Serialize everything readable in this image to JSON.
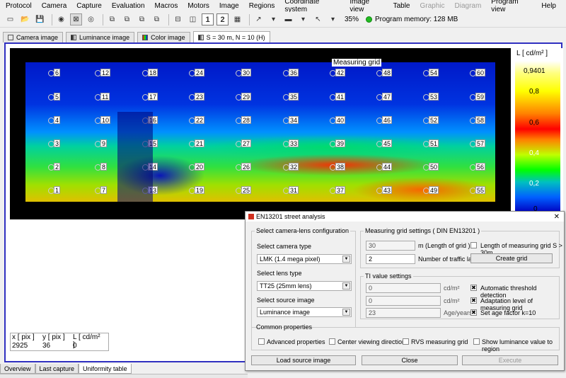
{
  "menu": [
    "Protocol",
    "Camera",
    "Capture",
    "Evaluation",
    "Macros",
    "Motors",
    "Image",
    "Regions",
    "Coordinate system",
    "Image view",
    "Table",
    "Graphic",
    "Diagram",
    "Program view",
    "Help"
  ],
  "menu_disabled": [
    "Graphic",
    "Diagram"
  ],
  "toolbar": {
    "zoom": "35%",
    "memory": "Program memory: 128 MB",
    "btn1": "1",
    "btn2": "2"
  },
  "image_tabs": [
    "Camera image",
    "Luminance image",
    "Color image",
    "S = 30 m, N = 10 (H)"
  ],
  "grid_label": "Measuring grid",
  "grid_points": [
    "6",
    "12",
    "18",
    "24",
    "30",
    "36",
    "42",
    "48",
    "54",
    "60",
    "5",
    "11",
    "17",
    "23",
    "29",
    "35",
    "41",
    "47",
    "53",
    "59",
    "4",
    "10",
    "16",
    "22",
    "28",
    "34",
    "40",
    "46",
    "52",
    "58",
    "3",
    "9",
    "15",
    "21",
    "27",
    "33",
    "39",
    "45",
    "51",
    "57",
    "2",
    "8",
    "14",
    "20",
    "26",
    "32",
    "38",
    "44",
    "50",
    "56",
    "1",
    "7",
    "13",
    "19",
    "25",
    "31",
    "37",
    "43",
    "49",
    "55"
  ],
  "legend": {
    "title": "L [ cd/m² ]",
    "max": "0,9401",
    "ticks": [
      "0,8",
      "0,6",
      "0,4",
      "0,2",
      "0"
    ]
  },
  "readout": {
    "h_x": "x [ pix ]",
    "h_y": "y [ pix ]",
    "h_l": "L [ cd/m² ]",
    "x": "2925",
    "y": "36",
    "l": "0"
  },
  "bottom_tabs": [
    "Overview",
    "Last capture",
    "Uniformity table"
  ],
  "dialog": {
    "title": "EN13201 street analysis",
    "camera_group": "Select camera-lens configuration",
    "camera_type_label": "Select camera type",
    "camera_type": "LMK (1.4 mega pixel)",
    "lens_label": "Select lens type",
    "lens": "TT25 (25mm lens)",
    "source_label": "Select source image",
    "source": "Luminance image",
    "grid_group": "Measuring grid settings ( DIN EN13201 )",
    "length": "30",
    "length_unit": "m (Length of grid )",
    "length_check": "Length of measuring grid S > 30m",
    "lanes": "2",
    "lanes_label": "Number of traffic lane",
    "create_grid": "Create grid",
    "ti_group": "TI value settings",
    "ti1": "0",
    "ti1_unit": "cd/m²",
    "ti1_check": "Automatic threshold detection",
    "ti2": "0",
    "ti2_unit": "cd/m²",
    "ti2_check": "Adaptation level of measuring grid",
    "ti3": "23",
    "ti3_unit": "Age/years",
    "ti3_check": "Set age factor k=10",
    "common_group": "Common properties",
    "advanced": "Advanced properties",
    "center": "Center viewing direction",
    "rvs": "RVS measuring grid",
    "show_lum": "Show luminance value to region",
    "load_source": "Load source image",
    "close": "Close",
    "execute": "Execute"
  }
}
